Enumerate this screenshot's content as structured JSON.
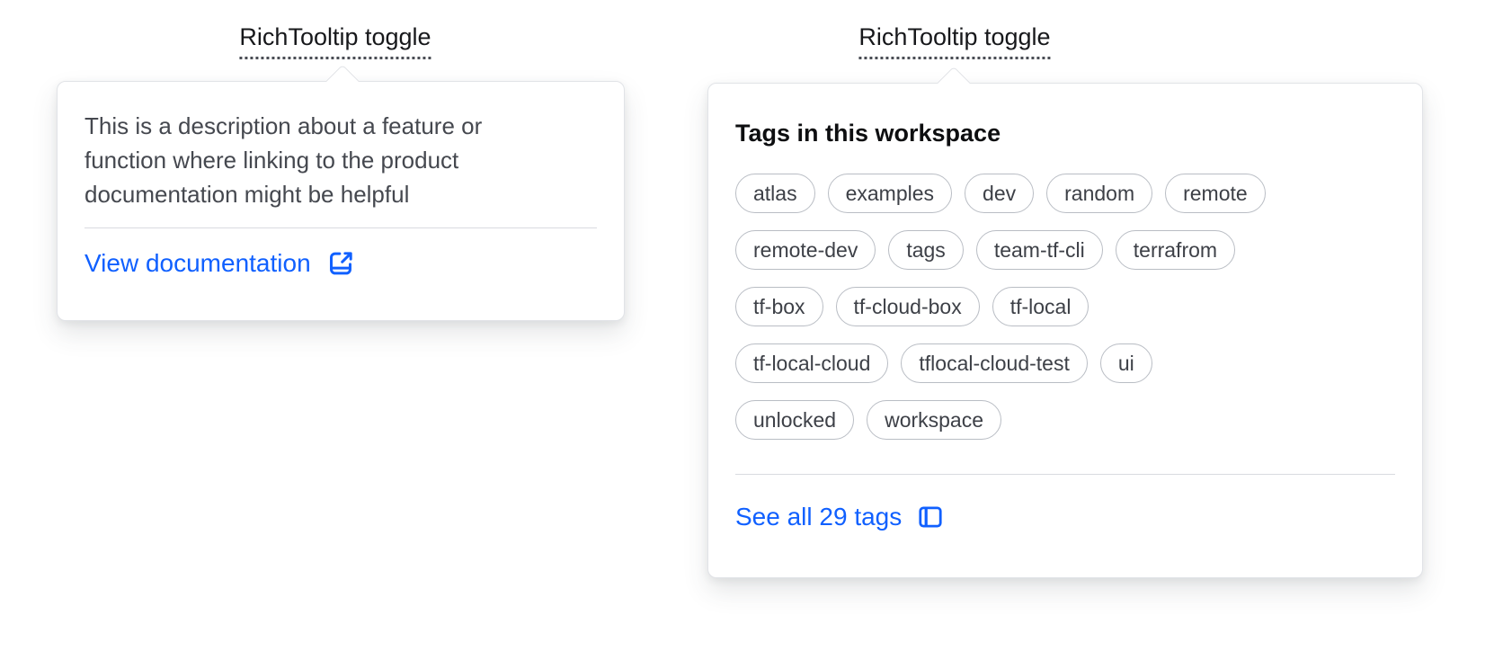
{
  "colors": {
    "link_blue": "#1060ff",
    "text_primary": "#45484f",
    "text_strong": "#0d0e10",
    "pill_border": "#b9bdc4",
    "card_border": "#e1e3e7"
  },
  "left_tooltip": {
    "toggle_label": "RichTooltip toggle",
    "description_lines": [
      "This is a description about a feature or",
      "function where linking to the product",
      "documentation might be helpful"
    ],
    "description_full": "This is a description about a feature or function where linking to the product documentation might be helpful",
    "link_label": "View documentation",
    "link_icon": "docs-link-external-icon"
  },
  "right_tooltip": {
    "toggle_label": "RichTooltip toggle",
    "heading": "Tags in this workspace",
    "tag_rows": [
      [
        "atlas",
        "examples",
        "dev",
        "random",
        "remote"
      ],
      [
        "remote-dev",
        "tags",
        "team-tf-cli",
        "terrafrom"
      ],
      [
        "tf-box",
        "tf-cloud-box",
        "tf-local"
      ],
      [
        "tf-local-cloud",
        "tflocal-cloud-test",
        "ui"
      ],
      [
        "unlocked",
        "workspace"
      ]
    ],
    "tags_shown_count": 17,
    "link_label": "See all 29 tags",
    "link_icon": "sidebar-icon"
  }
}
